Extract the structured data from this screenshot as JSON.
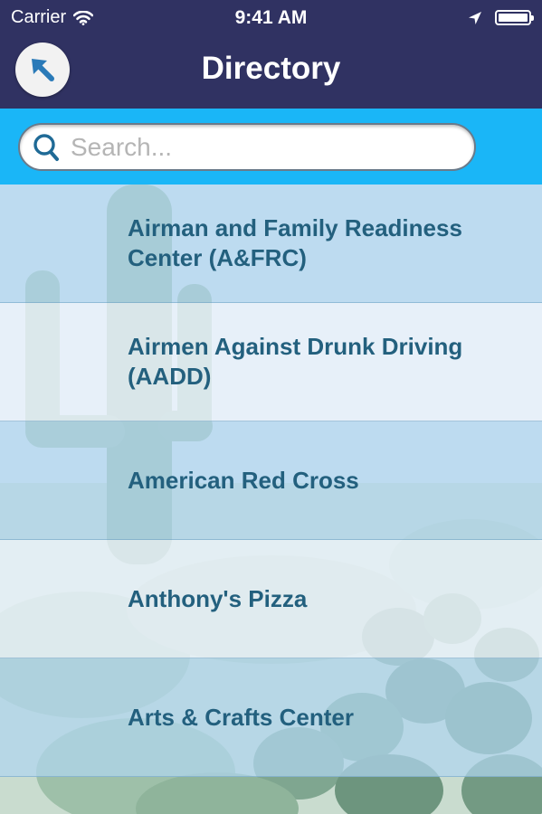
{
  "status_bar": {
    "carrier": "Carrier",
    "time": "9:41 AM"
  },
  "nav": {
    "title": "Directory",
    "back_icon": "arrow-up-left-icon"
  },
  "search": {
    "placeholder": "Search...",
    "value": ""
  },
  "directory": {
    "items": [
      {
        "label": "Airman and Family Readiness Center (A&FRC)"
      },
      {
        "label": "Airmen Against Drunk Driving (AADD)"
      },
      {
        "label": "American Red Cross"
      },
      {
        "label": "Anthony's Pizza"
      },
      {
        "label": "Arts & Crafts Center"
      }
    ]
  },
  "colors": {
    "nav_background": "#303262",
    "search_bar_background": "#1ab6f7",
    "item_text": "#23607e",
    "back_arrow": "#2a7ab8"
  }
}
